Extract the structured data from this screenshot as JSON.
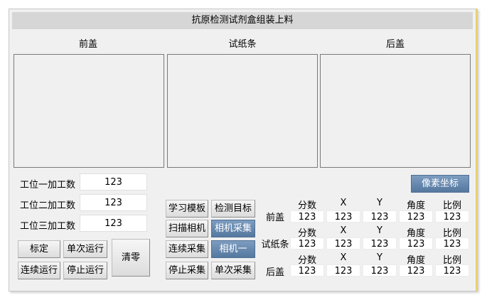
{
  "window": {
    "title": "抗原检测试剂盒组装上料"
  },
  "sections": [
    "前盖",
    "试纸条",
    "后盖"
  ],
  "counts": [
    {
      "label": "工位一加工数",
      "value": "123"
    },
    {
      "label": "工位二加工数",
      "value": "123"
    },
    {
      "label": "工位三加工数",
      "value": "123"
    }
  ],
  "buttons": {
    "calibrate": "标定",
    "single_run": "单次运行",
    "clear": "清零",
    "continuous_run": "连续运行",
    "stop_run": "停止运行",
    "learn_template": "学习模板",
    "detect_target": "检测目标",
    "scan_camera": "扫描相机",
    "camera_capture": "相机采集",
    "continuous_capture": "连续采集",
    "camera_one": "相机一",
    "stop_capture": "停止采集",
    "single_capture": "单次采集",
    "pixel_coords": "像素坐标"
  },
  "results": {
    "headers": [
      "分数",
      "X",
      "Y",
      "角度",
      "比例"
    ],
    "rows": [
      {
        "label": "前盖",
        "values": [
          "123",
          "123",
          "123",
          "123",
          "123"
        ]
      },
      {
        "label": "试纸条",
        "values": [
          "123",
          "123",
          "123",
          "123",
          "123"
        ]
      },
      {
        "label": "后盖",
        "values": [
          "123",
          "123",
          "123",
          "123",
          "123"
        ]
      }
    ]
  },
  "colors": {
    "accent_button": "#5f81a8",
    "title_bar": "#d6d6d6",
    "panel": "#f0f0f0"
  }
}
